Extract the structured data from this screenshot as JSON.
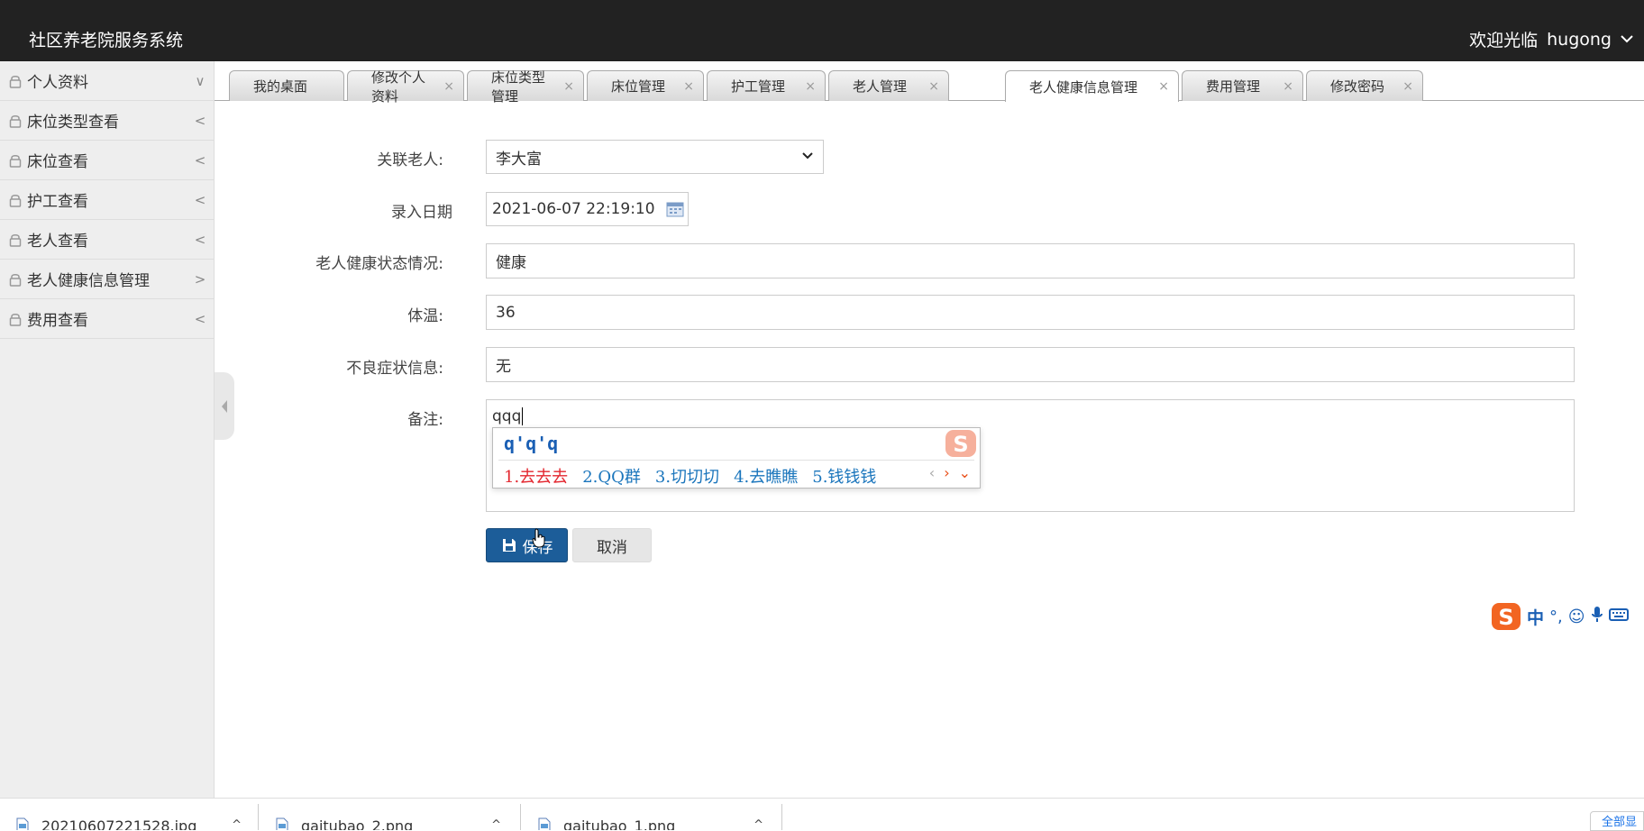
{
  "app": {
    "title": "社区养老院服务系统",
    "welcome": "欢迎光临",
    "user": "hugong"
  },
  "sidebar": {
    "items": [
      {
        "label": "个人资料",
        "arrow": "∨"
      },
      {
        "label": "床位类型查看",
        "arrow": "<"
      },
      {
        "label": "床位查看",
        "arrow": "<"
      },
      {
        "label": "护工查看",
        "arrow": "<"
      },
      {
        "label": "老人查看",
        "arrow": "<"
      },
      {
        "label": "老人健康信息管理",
        "arrow": ">"
      },
      {
        "label": "费用查看",
        "arrow": "<"
      }
    ]
  },
  "tabs": [
    {
      "label": "我的桌面",
      "closable": false
    },
    {
      "label": "修改个人资料",
      "closable": true
    },
    {
      "label": "床位类型管理",
      "closable": true
    },
    {
      "label": "床位管理",
      "closable": true
    },
    {
      "label": "护工管理",
      "closable": true
    },
    {
      "label": "老人管理",
      "closable": true
    },
    {
      "label": "老人健康信息管理",
      "closable": true,
      "active": true
    },
    {
      "label": "费用管理",
      "closable": true
    },
    {
      "label": "修改密码",
      "closable": true
    }
  ],
  "form": {
    "elder_label": "关联老人:",
    "elder_value": "李大富",
    "date_label": "录入日期",
    "date_value": "2021-06-07 22:19:10",
    "health_label": "老人健康状态情况:",
    "health_value": "健康",
    "temp_label": "体温:",
    "temp_value": "36",
    "symptom_label": "不良症状信息:",
    "symptom_value": "无",
    "remark_label": "备注:",
    "remark_value": "qqq"
  },
  "ime": {
    "composition": "q'q'q",
    "candidates": [
      "1.去去去",
      "2.QQ群",
      "3.切切切",
      "4.去瞧瞧",
      "5.钱钱钱"
    ],
    "prev": "‹",
    "next": "›",
    "expand": "⌄"
  },
  "buttons": {
    "save": "保存",
    "cancel": "取消"
  },
  "imebar": {
    "lang": "中",
    "punct": "°,",
    "emoji": "☺",
    "mic": "🎤",
    "keyboard": "⌨"
  },
  "downloads": [
    {
      "name": "20210607221528.jpg"
    },
    {
      "name": "gaitubao_2.png"
    },
    {
      "name": "gaitubao_1.png"
    }
  ],
  "downloads_show_all": "全部显示",
  "colors": {
    "topbar": "#222222",
    "primary": "#1c5d99",
    "ime_red": "#e3262e",
    "ime_blue": "#1a75bc"
  }
}
